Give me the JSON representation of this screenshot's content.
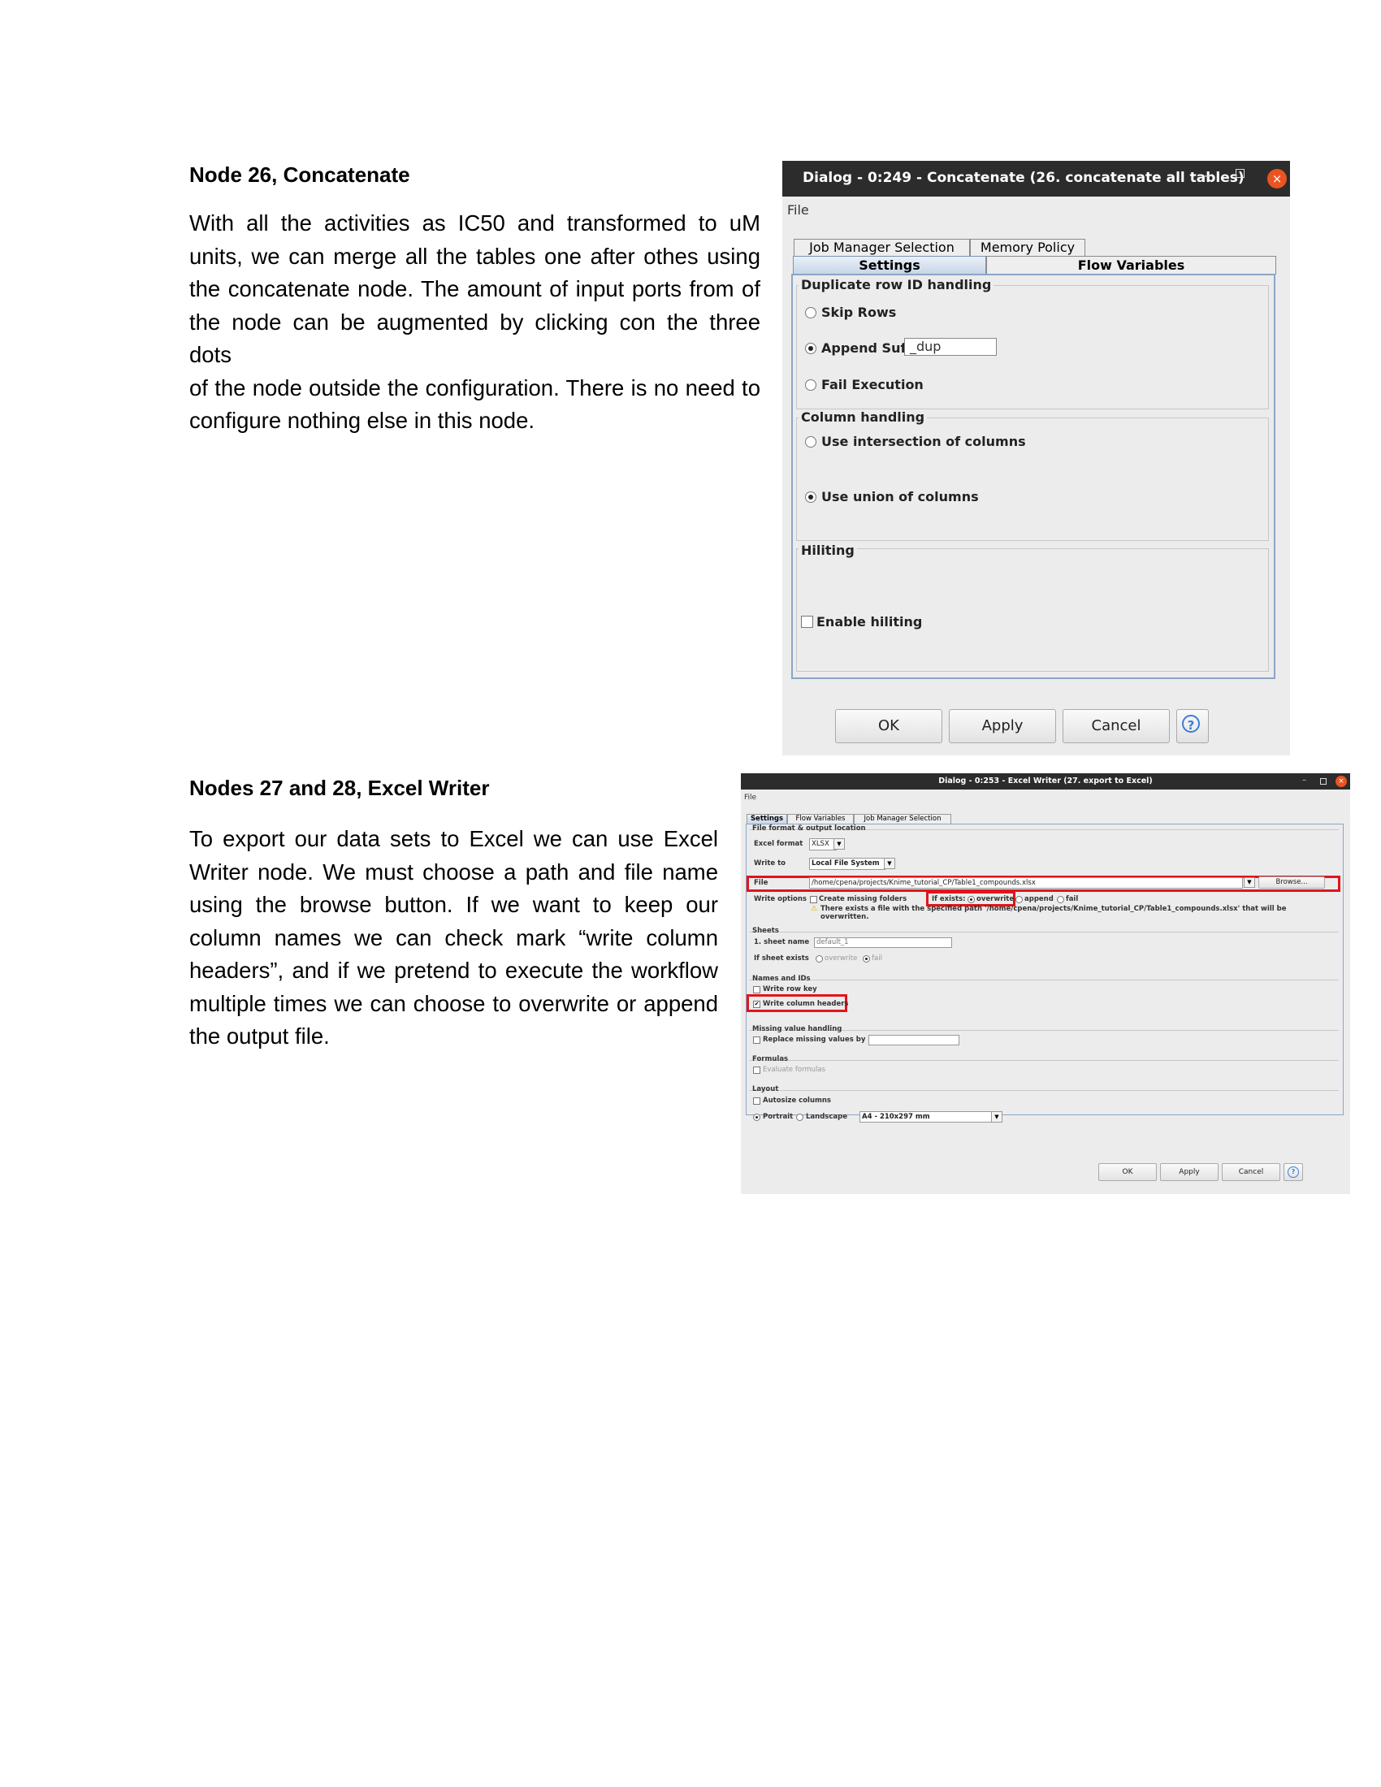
{
  "section1": {
    "heading": "Node 26, Concatenate",
    "lines": [
      "With all the activities as IC50 and transformed to uM",
      "units, we can merge all the tables one after othes using",
      "the concatenate node. The amount of input ports from of",
      "the node can be augmented by clicking con the three dots",
      "of the node outside the configuration. There is no need to",
      "configure nothing else in this node."
    ]
  },
  "section2": {
    "heading": "Nodes 27 and 28, Excel Writer",
    "lines": [
      "To export our data sets to Excel we can use Excel",
      "Writer node. We must choose a path and file name",
      "using the browse button. If we want to keep our",
      "column names we can check mark “write column",
      "headers”, and if we pretend to execute the workflow",
      "multiple times we can choose to overwrite or append",
      "the output file."
    ]
  },
  "dialog1": {
    "title": "Dialog - 0:249 - Concatenate (26. concatenate all tables)",
    "window_controls": [
      "–",
      "×"
    ],
    "menu": "File",
    "tabs_back": [
      "Job Manager Selection",
      "Memory Policy"
    ],
    "tabs_front": [
      "Settings",
      "Flow Variables"
    ],
    "duplicate": {
      "title": "Duplicate row ID handling",
      "skip": "Skip Rows",
      "append": "Append Suffix:",
      "suffix_value": "_dup",
      "fail": "Fail Execution",
      "selected": "append"
    },
    "columns": {
      "title": "Column handling",
      "intersection": "Use intersection of columns",
      "union": "Use union of columns",
      "selected": "union"
    },
    "hiliting": {
      "title": "Hiliting",
      "enable": "Enable hiliting",
      "checked": false
    },
    "buttons": {
      "ok": "OK",
      "apply": "Apply",
      "cancel": "Cancel",
      "help": "?"
    }
  },
  "dialog2": {
    "title": "Dialog - 0:253 - Excel Writer (27. export to Excel)",
    "window_controls": [
      "–",
      "×"
    ],
    "menu": "File",
    "tabs": [
      "Settings",
      "Flow Variables",
      "Job Manager Selection"
    ],
    "file_format": {
      "title": "File format & output location",
      "excel_format_label": "Excel format",
      "excel_format_value": "XLSX",
      "write_to_label": "Write to",
      "write_to_value": "Local File System",
      "file_label": "File",
      "file_path": "/home/cpena/projects/Knime_tutorial_CP/Table1_compounds.xlsx",
      "browse": "Browse...",
      "write_options_label": "Write options",
      "create_missing": "Create missing folders",
      "if_exists": "If exists:",
      "overwrite": "overwrite",
      "append": "append",
      "fail": "fail",
      "warning": "There exists a file with the specified path '/home/cpena/projects/Knime_tutorial_CP/Table1_compounds.xlsx' that will be",
      "warning2": "overwritten."
    },
    "sheets": {
      "title": "Sheets",
      "sheet_name_label": "1. sheet name",
      "sheet_name_value": "default_1",
      "if_sheet_exists_label": "If sheet exists",
      "overwrite": "overwrite",
      "fail": "fail"
    },
    "names": {
      "title": "Names and IDs",
      "row_key": "Write row key",
      "col_headers": "Write column headers"
    },
    "missing": {
      "title": "Missing value handling",
      "replace": "Replace missing values by"
    },
    "formulas": {
      "title": "Formulas",
      "evaluate": "Evaluate formulas"
    },
    "layout": {
      "title": "Layout",
      "autosize": "Autosize columns",
      "portrait": "Portrait",
      "landscape": "Landscape",
      "paper": "A4 - 210x297 mm"
    },
    "buttons": {
      "ok": "OK",
      "apply": "Apply",
      "cancel": "Cancel",
      "help": "?"
    }
  }
}
